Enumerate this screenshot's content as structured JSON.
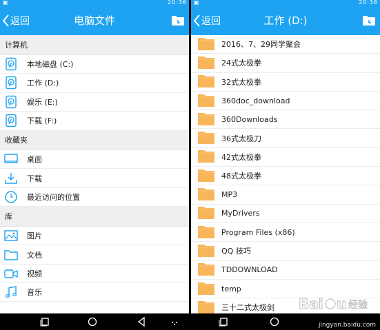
{
  "status": {
    "time": "20:36",
    "time_right": "20:36"
  },
  "left": {
    "back_label": "返回",
    "title": "电脑文件",
    "sections": [
      {
        "header": "计算机",
        "items": [
          {
            "label": "本地磁盘 (C:)",
            "icon": "hard-disk-icon"
          },
          {
            "label": "工作 (D:)",
            "icon": "hard-disk-icon"
          },
          {
            "label": "娱乐 (E:)",
            "icon": "hard-disk-icon"
          },
          {
            "label": "下载 (F:)",
            "icon": "hard-disk-icon"
          }
        ]
      },
      {
        "header": "收藏夹",
        "items": [
          {
            "label": "桌面",
            "icon": "desktop-icon"
          },
          {
            "label": "下载",
            "icon": "download-icon"
          },
          {
            "label": "最近访问的位置",
            "icon": "clock-icon"
          }
        ]
      },
      {
        "header": "库",
        "items": [
          {
            "label": "图片",
            "icon": "image-icon"
          },
          {
            "label": "文档",
            "icon": "folder-outline-icon"
          },
          {
            "label": "视频",
            "icon": "video-icon"
          },
          {
            "label": "音乐",
            "icon": "music-icon"
          }
        ]
      }
    ]
  },
  "right": {
    "back_label": "返回",
    "title": "工作 (D:)",
    "folders": [
      "2016、7、29同学聚会",
      "24式太极拳",
      "32式太极拳",
      "360doc_download",
      "360Downloads",
      "36式太极刀",
      "42式太极拳",
      "48式太极拳",
      "MP3",
      "MyDrivers",
      "Program Files (x86)",
      "QQ 技巧",
      "TDDOWNLOAD",
      "temp",
      "三十二式太极剑"
    ]
  },
  "watermark": {
    "text": "jingyan.baidu.com"
  },
  "colors": {
    "accent": "#1da3f2",
    "folder": "#f8b55a",
    "icon": "#1da3f2"
  }
}
